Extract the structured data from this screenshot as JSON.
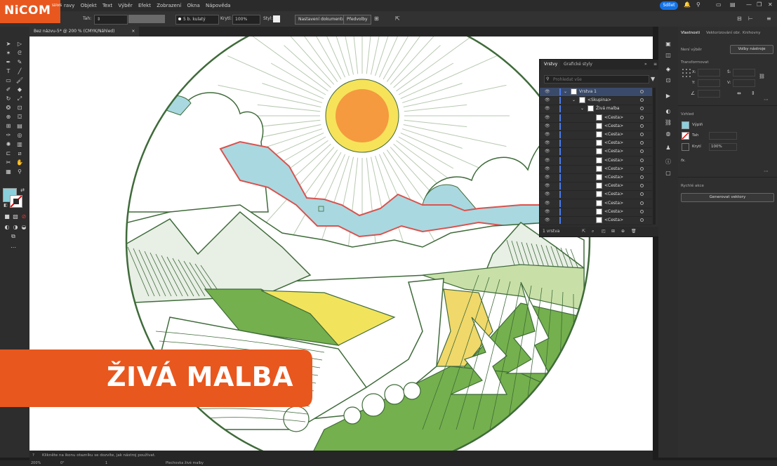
{
  "logo": {
    "text": "NiCOM",
    "sub": "SERVIS"
  },
  "menubar": {
    "menus": [
      "ravy",
      "Objekt",
      "Text",
      "Výběr",
      "Efekt",
      "Zobrazení",
      "Okna",
      "Nápověda"
    ],
    "share_label": "Sdílet"
  },
  "controlbar": {
    "stroke_label": "Tah:",
    "brush_value": "5 b. kulatý",
    "opacity_label": "Krytí:",
    "opacity_value": "100%",
    "style_label": "Styl:",
    "doc_settings_label": "Nastavení dokumentu",
    "prefs_label": "Předvolby"
  },
  "document": {
    "tab_title": "Bez názvu-5* @ 200 % (CMYK/Náhled)",
    "close": "×"
  },
  "layers_panel": {
    "tabs": [
      "Vrstvy",
      "Grafické styly"
    ],
    "search_placeholder": "Prohledat vše",
    "rows": [
      {
        "name": "Vrstva 1",
        "level": 0
      },
      {
        "name": "<Skupina>",
        "level": 1
      },
      {
        "name": "Živá malba",
        "level": 2
      },
      {
        "name": "<Cesta>",
        "level": 3
      },
      {
        "name": "<Cesta>",
        "level": 3
      },
      {
        "name": "<Cesta>",
        "level": 3
      },
      {
        "name": "<Cesta>",
        "level": 3
      },
      {
        "name": "<Cesta>",
        "level": 3
      },
      {
        "name": "<Cesta>",
        "level": 3
      },
      {
        "name": "<Cesta>",
        "level": 3
      },
      {
        "name": "<Cesta>",
        "level": 3
      },
      {
        "name": "<Cesta>",
        "level": 3
      },
      {
        "name": "<Cesta>",
        "level": 3
      },
      {
        "name": "<Cesta>",
        "level": 3
      },
      {
        "name": "<Cesta>",
        "level": 3
      },
      {
        "name": "<Cesta>",
        "level": 3
      }
    ],
    "footer_count": "1 vrstva"
  },
  "properties": {
    "tabs": [
      "Vlastnosti",
      "Vektorizování obr.",
      "Knihovny"
    ],
    "no_selection": "Není výběr",
    "tool_options_label": "Volby nástroje",
    "transform_title": "Transformovat",
    "appearance_title": "Vzhled",
    "fill_label": "Výplň",
    "stroke_label": "Tah",
    "opacity_label": "Krytí",
    "opacity_value": "100%",
    "fx_label": "fx.",
    "quick_actions_title": "Rychlé akce",
    "generate_vectors_label": "Generovat vektory"
  },
  "statusbar": {
    "hint": "Klikněte na ikonu otazníku se dozvíte, jak nástroj používat.",
    "zoom": "200%",
    "rotation": "0°",
    "artboard": "1",
    "tool": "Plechovka živé malby"
  },
  "banner": {
    "text": "ŽIVÁ MALBA"
  },
  "colors": {
    "accent_orange": "#e8571e",
    "sky_blue": "#a9d8e0",
    "outline_red": "#d9534f",
    "line_green": "#3f6b3a",
    "field_green": "#74b04d",
    "field_yellow": "#f1e45c",
    "sun_yellow": "#f6e35a",
    "sun_orange": "#f59a3e",
    "fill_swatch": "#8ad0dc"
  }
}
